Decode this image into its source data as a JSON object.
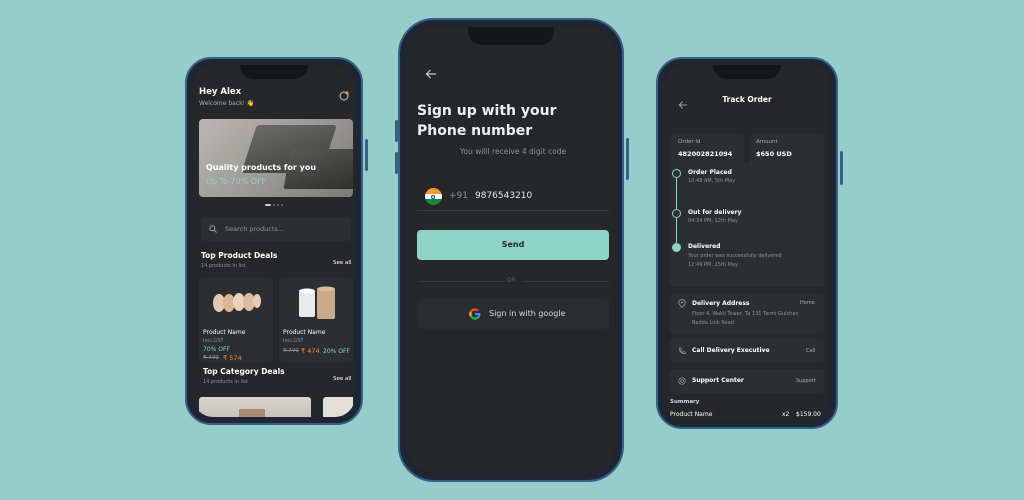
{
  "left": {
    "greeting": "Hey Alex",
    "welcome": "Welcome back! 👋",
    "banner": {
      "title": "Quality products for you",
      "subtitle": "Up To 70% OFF"
    },
    "search": {
      "placeholder": "Search products..."
    },
    "top_deals": {
      "title": "Top Product Deals",
      "subtitle": "14 products in list",
      "see_all": "See all",
      "products": [
        {
          "name": "Product Name",
          "tax": "incl.GST",
          "discount": "70% OFF",
          "old_price": "₹ 770",
          "price": "₹ 574"
        },
        {
          "name": "Product Name",
          "tax": "incl.GST",
          "old_price": "₹ 770",
          "price": "₹ 474",
          "discount": "20% OFF"
        }
      ]
    },
    "top_category": {
      "title": "Top Category  Deals",
      "subtitle": "14 products in list",
      "see_all": "See all"
    }
  },
  "center": {
    "title_line1": "Sign up with your",
    "title_line2": "Phone number",
    "subtitle": "You willl receive 4 digit code",
    "country_code": "+91",
    "phone_value": "9876543210",
    "send_label": "Send",
    "or_label": "OR",
    "google_label": "Sign in with google"
  },
  "right": {
    "title": "Track Order",
    "order_id_label": "Order Id",
    "order_id": "482002821094",
    "amount_label": "Amount",
    "amount": "$650 USD",
    "steps": [
      {
        "title": "Order Placed",
        "time": "10:48 AM, 5th May"
      },
      {
        "title": "Out for delivery",
        "time": "04:34 PM, 12th May"
      },
      {
        "title": "Delivered",
        "desc": "Your order was successfully delivered",
        "time": "12:49 PM, 15th May"
      }
    ],
    "address": {
      "label": "Delivery Address",
      "tag": "Home",
      "line1": "Floor 4, Wakil Tower, Ta 131 Termi Gulshan",
      "line2": "Badda Link Road"
    },
    "call": {
      "label": "Call Delivery Executive",
      "action": "Call"
    },
    "support": {
      "label": "Support Center",
      "action": "Support"
    },
    "summary": {
      "title": "Summary",
      "item": "Product Name",
      "qty": "x2",
      "price": "$159.00"
    }
  },
  "colors": {
    "background": "#94cdca",
    "accent": "#8fd3c7",
    "screen": "#252729",
    "card": "#2c2f31",
    "price": "#f08a3c"
  }
}
